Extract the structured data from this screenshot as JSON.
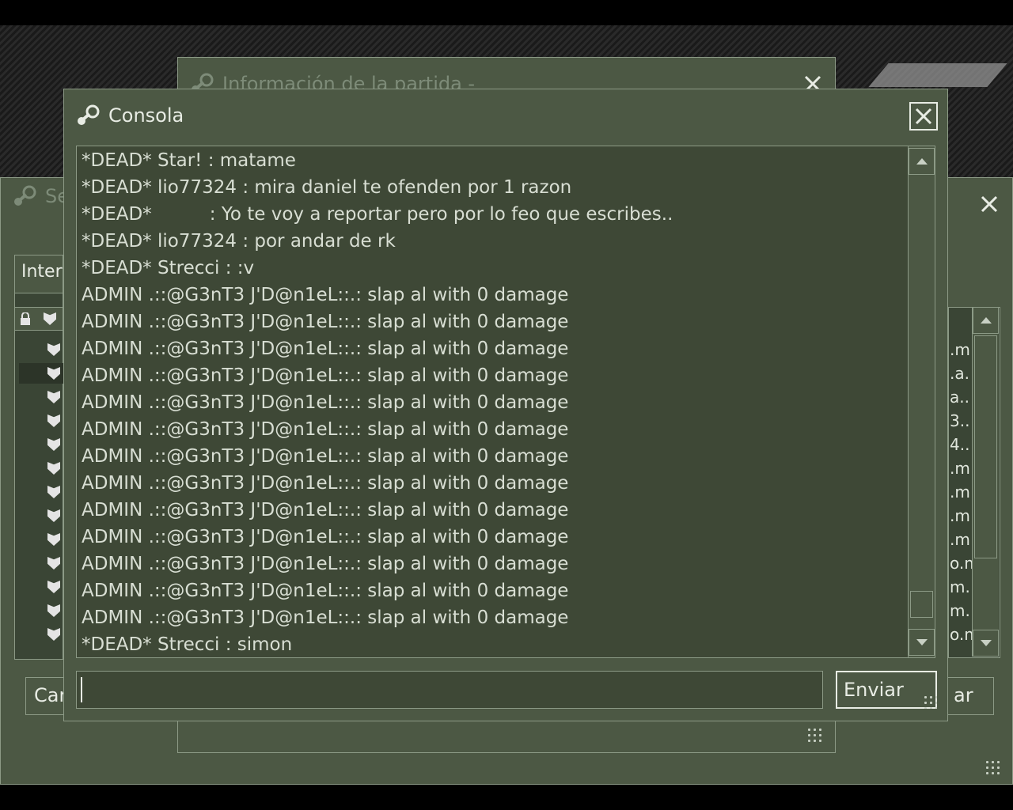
{
  "background": {
    "servers_window": {
      "title_fragment": "Se",
      "tab_label_fragment": "Inter",
      "left_button_fragment": "Car",
      "right_button_fragment": "ar",
      "right_column_fragments": [
        ".m",
        ".a.",
        "a..",
        "3..",
        "4..",
        ".m",
        ".m",
        ".m",
        ".m",
        "o.m",
        "m.",
        "m.",
        "o.m"
      ]
    },
    "info_window": {
      "title": "Información de la partida -"
    }
  },
  "console": {
    "title": "Consola",
    "log_lines": [
      "*DEAD* Star! : matame",
      "*DEAD* lio77324 : mira daniel te ofenden por 1 razon",
      "*DEAD*          : Yo te voy a reportar pero por lo feo que escribes..",
      "*DEAD* lio77324 : por andar de rk",
      "*DEAD* Strecci : :v",
      "ADMIN .::@G3nT3 J'D@n1eL::.: slap al with 0 damage",
      "ADMIN .::@G3nT3 J'D@n1eL::.: slap al with 0 damage",
      "ADMIN .::@G3nT3 J'D@n1eL::.: slap al with 0 damage",
      "ADMIN .::@G3nT3 J'D@n1eL::.: slap al with 0 damage",
      "ADMIN .::@G3nT3 J'D@n1eL::.: slap al with 0 damage",
      "ADMIN .::@G3nT3 J'D@n1eL::.: slap al with 0 damage",
      "ADMIN .::@G3nT3 J'D@n1eL::.: slap al with 0 damage",
      "ADMIN .::@G3nT3 J'D@n1eL::.: slap al with 0 damage",
      "ADMIN .::@G3nT3 J'D@n1eL::.: slap al with 0 damage",
      "ADMIN .::@G3nT3 J'D@n1eL::.: slap al with 0 damage",
      "ADMIN .::@G3nT3 J'D@n1eL::.: slap al with 0 damage",
      "ADMIN .::@G3nT3 J'D@n1eL::.: slap al with 0 damage",
      "ADMIN .::@G3nT3 J'D@n1eL::.: slap al with 0 damage",
      "*DEAD* Strecci : simon"
    ],
    "input_value": "",
    "send_label": "Enviar"
  },
  "icons": {
    "window_icon": "steam-icon",
    "close": "close-icon",
    "scroll_up": "arrow-up-icon",
    "scroll_down": "arrow-down-icon"
  }
}
